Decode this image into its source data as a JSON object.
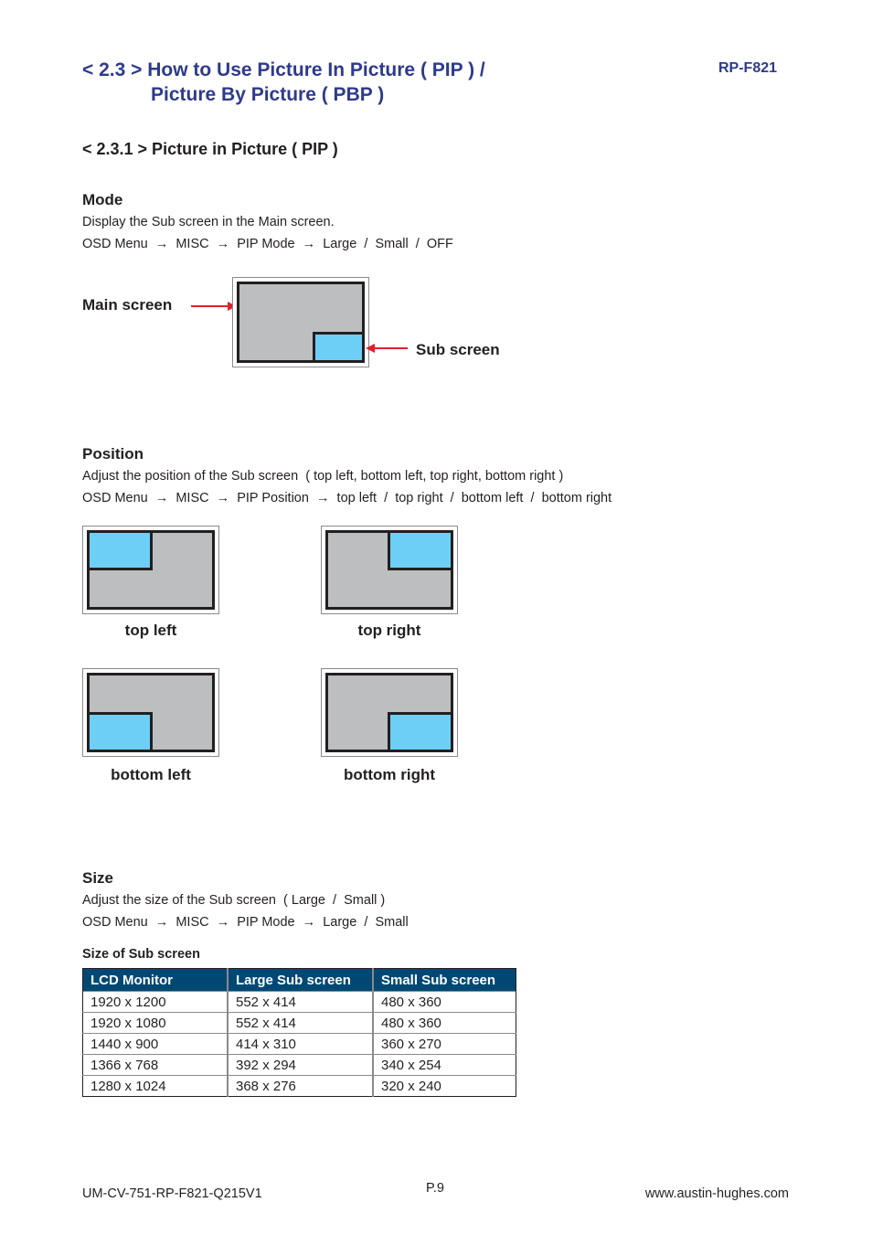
{
  "header": {
    "title_line1": "< 2.3 > How to Use Picture In Picture ( PIP )  /",
    "title_line2": "Picture By Picture ( PBP )",
    "model": "RP-F821"
  },
  "section": {
    "heading": "< 2.3.1 > Picture in Picture ( PIP )"
  },
  "mode": {
    "heading": "Mode",
    "description": "Display the Sub screen in the Main screen.",
    "path": "OSD Menu  →  MISC  →  PIP Mode  →  Large  /  Small  /  OFF",
    "main_screen_label": "Main screen",
    "sub_screen_label": "Sub screen"
  },
  "position": {
    "heading": "Position",
    "description": "Adjust the position of the Sub screen  ( top left, bottom left, top right, bottom right )",
    "path": "OSD Menu  →  MISC  →  PIP Position  →  top left  /  top right  /  bottom left  /  bottom right",
    "diagrams": [
      {
        "label": "top left"
      },
      {
        "label": "top right"
      },
      {
        "label": "bottom left"
      },
      {
        "label": "bottom right"
      }
    ]
  },
  "size": {
    "heading": "Size",
    "description": "Adjust the size of the Sub screen  ( Large  /  Small )",
    "path": "OSD Menu  →  MISC  →  PIP Mode  →  Large  /  Small",
    "table_title": "Size of Sub screen",
    "table": {
      "headers": [
        "LCD Monitor",
        "Large Sub screen",
        "Small Sub screen"
      ],
      "rows": [
        [
          "1920 x 1200",
          "552 x 414",
          "480 x 360"
        ],
        [
          "1920 x 1080",
          "552 x 414",
          "480 x 360"
        ],
        [
          "1440 x 900",
          "414 x 310",
          "360 x 270"
        ],
        [
          "1366 x 768",
          "392 x 294",
          "340 x 254"
        ],
        [
          "1280 x 1024",
          "368 x 276",
          "320 x 240"
        ]
      ]
    }
  },
  "footer": {
    "doc_code": "UM-CV-751-RP-F821-Q215V1",
    "page": "P.9",
    "website": "www.austin-hughes.com"
  },
  "colors": {
    "title_blue": "#2e3a8c",
    "table_header": "#004874",
    "sub_screen": "#6dcff6",
    "main_screen": "#bcbec0",
    "arrow_red": "#e0202a"
  }
}
